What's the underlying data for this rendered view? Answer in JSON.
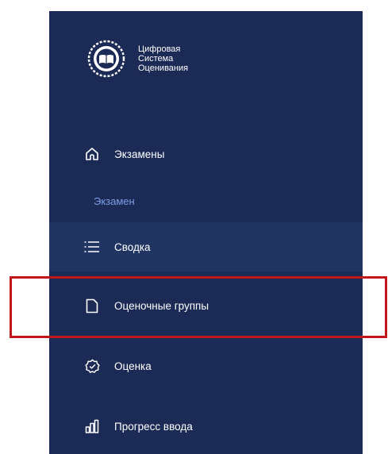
{
  "brand": {
    "name": "Цифровая\nСистема\nОценивания",
    "logo_icon": "emblem-book-icon"
  },
  "nav": {
    "top_item": {
      "label": "Экзамены",
      "icon": "home-icon"
    },
    "section_label": "Экзамен",
    "items": [
      {
        "label": "Сводка",
        "icon": "list-icon",
        "active": true
      },
      {
        "label": "Оценочные группы",
        "icon": "file-icon",
        "active": false,
        "highlighted": true
      },
      {
        "label": "Оценка",
        "icon": "badge-check-icon",
        "active": false
      },
      {
        "label": "Прогресс ввода",
        "icon": "bar-chart-icon",
        "active": false
      }
    ]
  },
  "colors": {
    "sidebar_bg": "#1b2b55",
    "active_bg": "#213563",
    "section_label": "#7f9de8",
    "highlight_border": "#c0171a",
    "text": "#ffffff"
  }
}
